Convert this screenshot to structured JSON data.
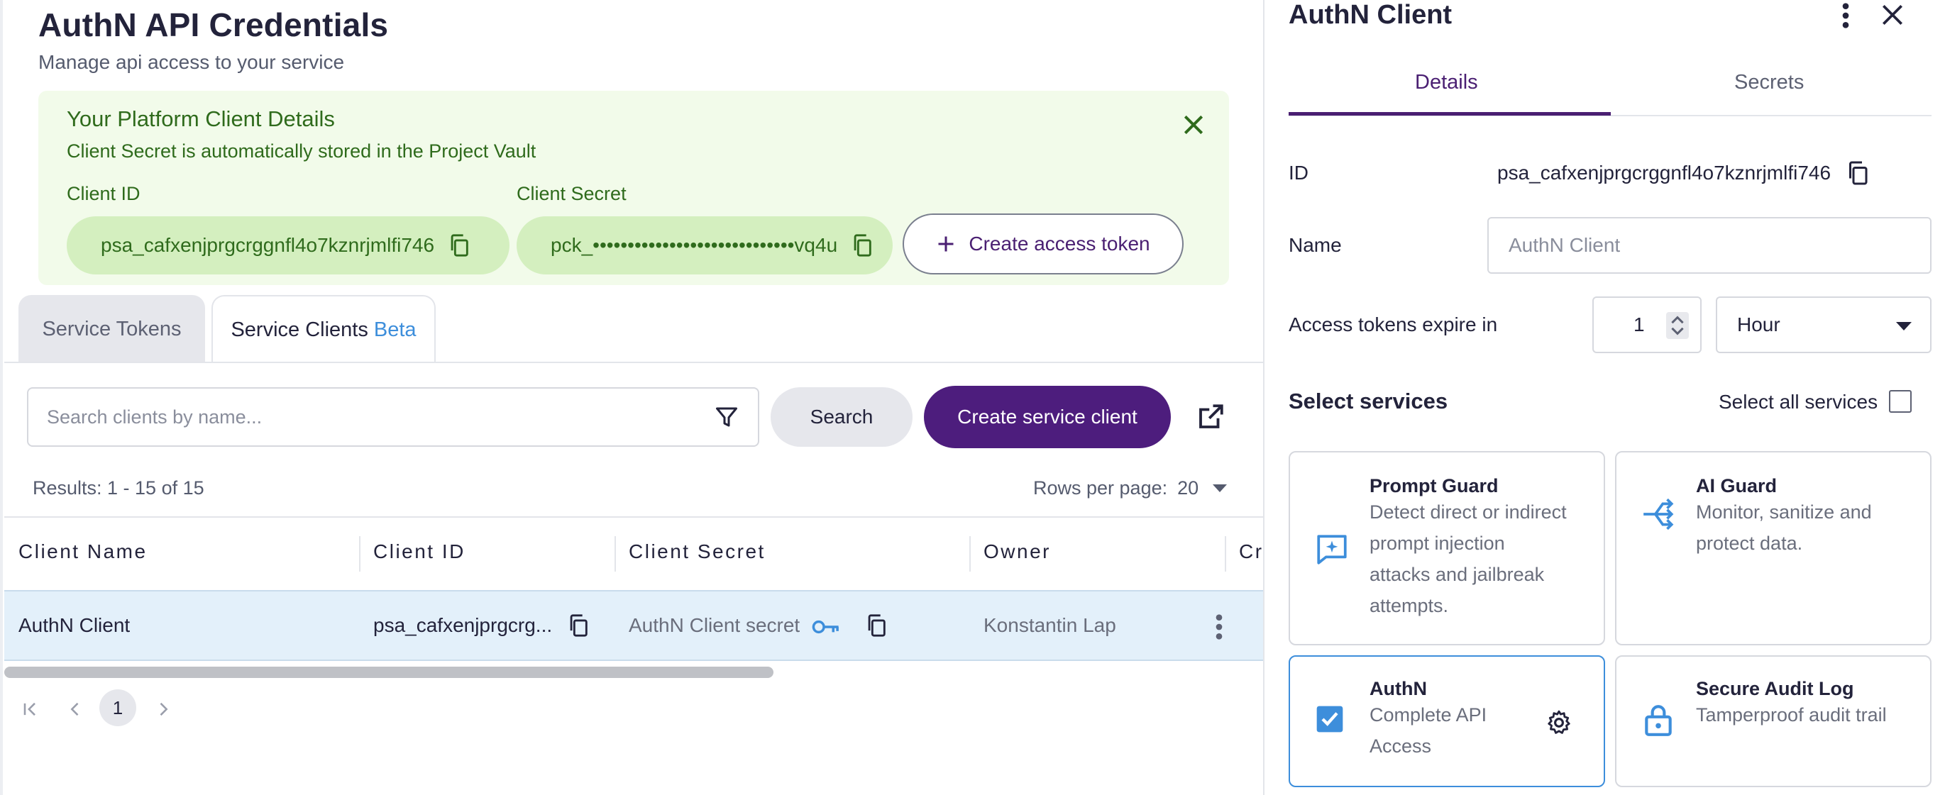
{
  "main": {
    "title": "AuthN API Credentials",
    "subtitle": "Manage api access to your service",
    "banner": {
      "title": "Your Platform Client Details",
      "subtitle": "Client Secret is automatically stored in the Project Vault",
      "client_id_label": "Client ID",
      "client_id_value": "psa_cafxenjprgcrggnfl4o7kznrjmlfi746",
      "client_secret_label": "Client Secret",
      "client_secret_value": "pck_•••••••••••••••••••••••••••••vq4u",
      "token_button": "Create access token"
    },
    "tabs": [
      {
        "label": "Service Tokens"
      },
      {
        "label": "Service Clients",
        "badge": "Beta"
      }
    ],
    "search": {
      "placeholder": "Search clients by name...",
      "search_button": "Search",
      "create_button": "Create service client"
    },
    "results_text": "Results: 1 - 15 of 15",
    "rows_per_page_label": "Rows per page:",
    "rows_per_page_value": "20",
    "columns": [
      "Client Name",
      "Client ID",
      "Client Secret",
      "Owner",
      "Cr"
    ],
    "rows": [
      {
        "name": "AuthN Client",
        "client_id": "psa_cafxenjprgcrg...",
        "secret": "AuthN Client secret",
        "owner": "Konstantin Lap"
      }
    ],
    "pagination": {
      "current": "1"
    }
  },
  "panel": {
    "title": "AuthN Client",
    "tabs": [
      "Details",
      "Secrets"
    ],
    "id_label": "ID",
    "id_value": "psa_cafxenjprgcrggnfl4o7kznrjmlfi746",
    "name_label": "Name",
    "name_placeholder": "AuthN Client",
    "expire_label": "Access tokens expire in",
    "expire_value": "1",
    "expire_unit": "Hour",
    "services_title": "Select services",
    "select_all_label": "Select all services",
    "services": [
      {
        "title": "Prompt Guard",
        "desc": [
          "Detect direct or indirect",
          "prompt injection",
          "attacks and jailbreak",
          "attempts."
        ],
        "icon": "prompt-guard-icon"
      },
      {
        "title": "AI Guard",
        "desc": [
          "Monitor, sanitize and",
          "protect data."
        ],
        "icon": "ai-guard-icon"
      },
      {
        "title": "AuthN",
        "desc": [
          "Complete API",
          "Access"
        ],
        "icon": "checkbox-checked-icon"
      },
      {
        "title": "Secure Audit Log",
        "desc": [
          "Tamperproof audit trail"
        ],
        "icon": "lock-icon"
      }
    ]
  },
  "colors": {
    "brand_purple": "#4d1d7d",
    "accent_blue": "#3d8edb",
    "banner_green": "#2f6b1c",
    "banner_bg": "#f2fbea"
  }
}
